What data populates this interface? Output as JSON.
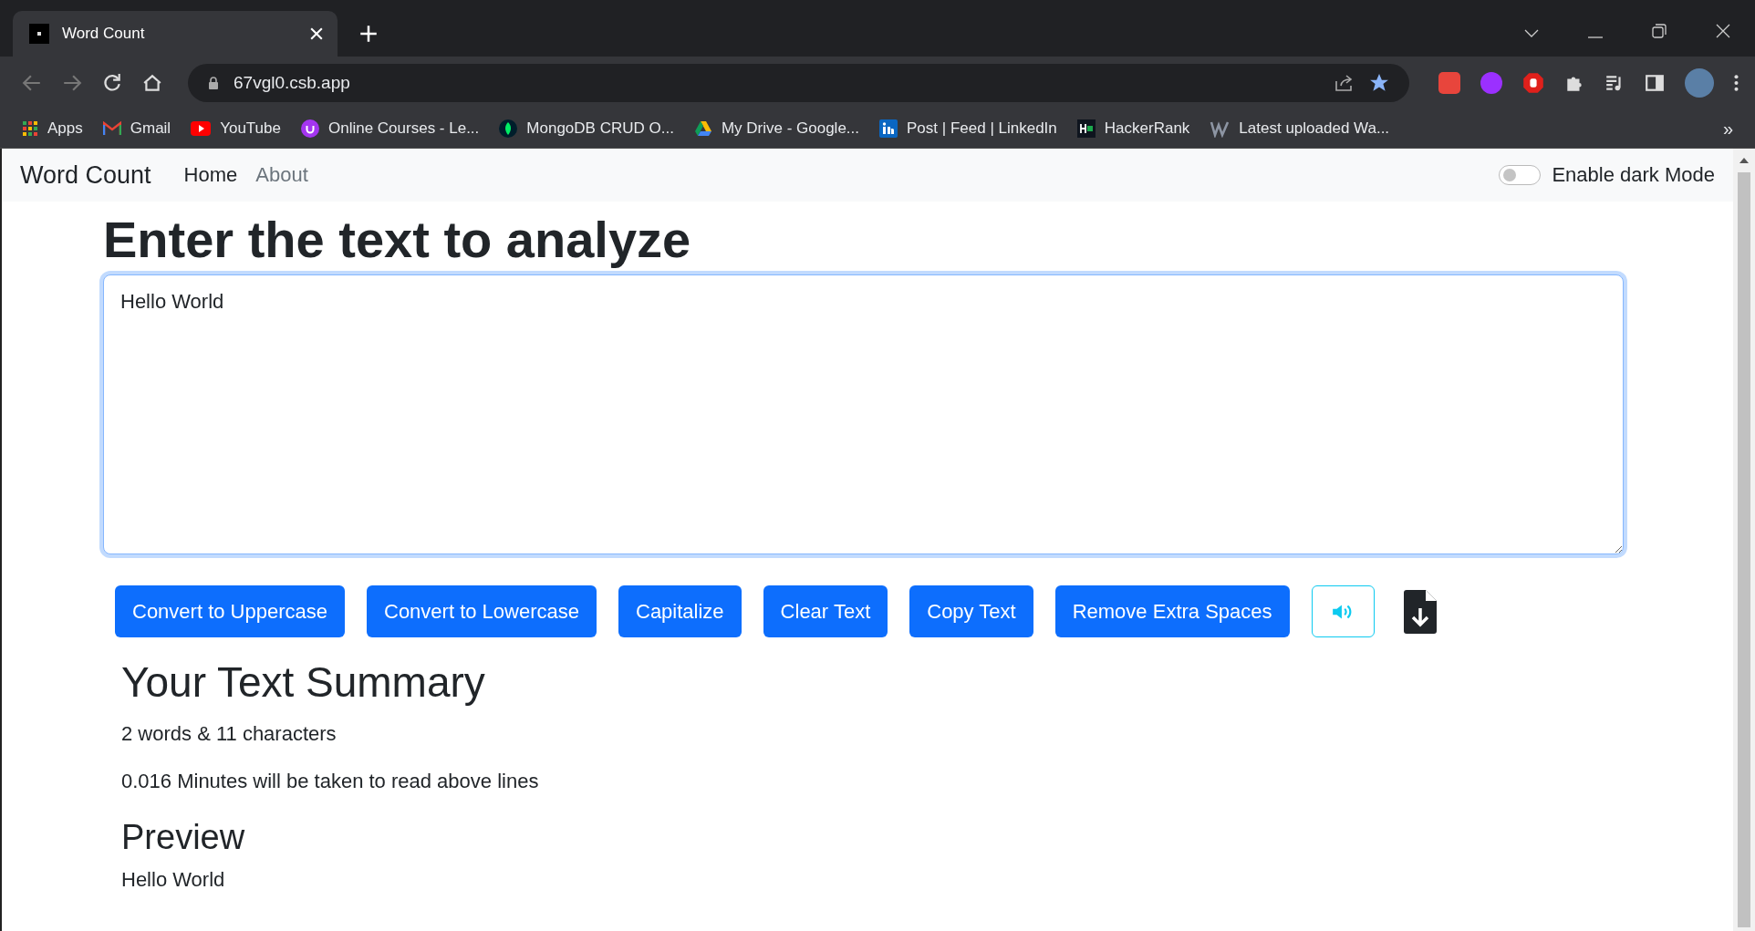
{
  "browser": {
    "tab_title": "Word Count",
    "url": "67vgl0.csb.app",
    "bookmarks": [
      {
        "label": "Apps",
        "kind": "apps"
      },
      {
        "label": "Gmail",
        "kind": "gmail"
      },
      {
        "label": "YouTube",
        "kind": "youtube"
      },
      {
        "label": "Online Courses - Le...",
        "kind": "udemy"
      },
      {
        "label": "MongoDB CRUD O...",
        "kind": "leaf"
      },
      {
        "label": "My Drive - Google...",
        "kind": "drive"
      },
      {
        "label": "Post | Feed | LinkedIn",
        "kind": "linkedin"
      },
      {
        "label": "HackerRank",
        "kind": "hackerrank"
      },
      {
        "label": "Latest uploaded Wa...",
        "kind": "w"
      }
    ],
    "bookmarks_overflow": "»"
  },
  "navbar": {
    "brand": "Word Count",
    "links": [
      {
        "label": "Home",
        "selected": true
      },
      {
        "label": "About",
        "selected": false
      }
    ],
    "dark_mode": {
      "label": "Enable dark Mode",
      "on": false
    }
  },
  "editor": {
    "heading": "Enter the text to analyze",
    "value": "Hello World",
    "buttons": [
      {
        "label": "Convert to Uppercase",
        "kind": "text"
      },
      {
        "label": "Convert to Lowercase",
        "kind": "text"
      },
      {
        "label": "Capitalize",
        "kind": "text"
      },
      {
        "label": "Clear Text",
        "kind": "text"
      },
      {
        "label": "Copy Text",
        "kind": "text"
      },
      {
        "label": "Remove Extra Spaces",
        "kind": "text"
      },
      {
        "kind": "speak"
      },
      {
        "kind": "download"
      }
    ]
  },
  "summary": {
    "heading": "Your Text Summary",
    "lines": [
      "2 words & 11 characters",
      "0.016 Minutes will be taken to read above lines"
    ],
    "preview_heading": "Preview",
    "preview_text": "Hello World"
  }
}
